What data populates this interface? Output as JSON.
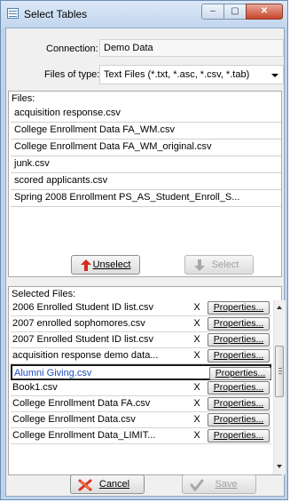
{
  "window": {
    "title": "Select Tables",
    "minimize_label": "–",
    "maximize_label": "▢",
    "close_label": "✕"
  },
  "connection": {
    "label": "Connection:",
    "value": "Demo Data"
  },
  "files_of_type": {
    "label": "Files of type:",
    "value": "Text Files (*.txt, *.asc, *.csv, *.tab)"
  },
  "files": {
    "label": "Files:",
    "items": [
      "acquisition response.csv",
      "College Enrollment Data FA_WM.csv",
      "College Enrollment Data FA_WM_original.csv",
      "junk.csv",
      "scored applicants.csv",
      "Spring 2008 Enrollment PS_AS_Student_Enroll_S..."
    ]
  },
  "buttons": {
    "unselect_label": "Unselect",
    "select_label": "Select",
    "cancel_label": "Cancel",
    "save_label": "Save"
  },
  "selected_files": {
    "label": "Selected Files:",
    "rows": [
      {
        "name": "2006 Enrolled Student ID list.csv",
        "remove": "X",
        "properties": "Properties..."
      },
      {
        "name": "2007 enrolled sophomores.csv",
        "remove": "X",
        "properties": "Properties..."
      },
      {
        "name": "2007 Enrolled Student ID list.csv",
        "remove": "X",
        "properties": "Properties..."
      },
      {
        "name": "acquisition response demo data...",
        "remove": "X",
        "properties": "Properties..."
      },
      {
        "name": "Alumni Giving.csv",
        "remove": "",
        "properties": "Properties..."
      },
      {
        "name": "Book1.csv",
        "remove": "X",
        "properties": "Properties..."
      },
      {
        "name": "College Enrollment Data FA.csv",
        "remove": "X",
        "properties": "Properties..."
      },
      {
        "name": "College Enrollment Data.csv",
        "remove": "X",
        "properties": "Properties..."
      },
      {
        "name": "College Enrollment Data_LIMIT...",
        "remove": "X",
        "properties": "Properties..."
      }
    ]
  },
  "colors": {
    "titlebar": "#c3d6ee",
    "close_button": "#c8452b",
    "active_row_text": "#1f4fbf",
    "unselect_arrow": "#d42a1c",
    "select_arrow": "#a8a8a8",
    "cancel_icon": "#e0302a"
  }
}
